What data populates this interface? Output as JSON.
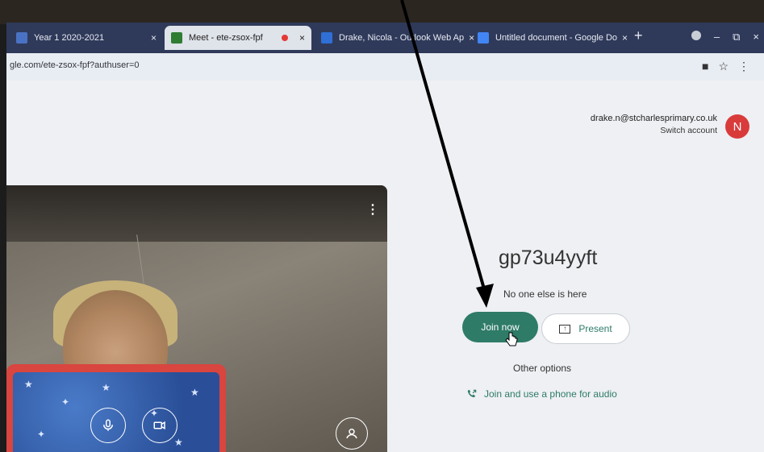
{
  "browser": {
    "tabs": [
      {
        "title": "Year 1 2020-2021",
        "close": "×",
        "favicon_color": "#4a72c4"
      },
      {
        "title": "Meet - ete-zsox-fpf",
        "close": "×",
        "favicon_color": "#2e7d32"
      },
      {
        "title": "Drake, Nicola - Outlook Web Ap",
        "close": "×",
        "favicon_color": "#2f6fd6"
      },
      {
        "title": "Untitled document - Google Do",
        "close": "×",
        "favicon_color": "#4285f4"
      }
    ],
    "new_tab_label": "+",
    "window_controls": {
      "minimize": "–",
      "restore": "⧉",
      "close": "×"
    },
    "url": "gle.com/ete-zsox-fpf?authuser=0",
    "address_icons": {
      "camera": "■",
      "bookmark": "☆",
      "menu": "⋮"
    }
  },
  "account": {
    "email": "drake.n@stcharlesprimary.co.uk",
    "switch_label": "Switch account",
    "avatar_letter": "N",
    "avatar_color": "#d93b3b"
  },
  "preview": {
    "menu_glyph": "⋮"
  },
  "meeting": {
    "code": "gp73u4yyft",
    "status": "No one else is here",
    "join_label": "Join now",
    "present_label": "Present",
    "present_icon_glyph": "↑",
    "other_options": "Other options",
    "phone_audio": "Join and use a phone for audio"
  },
  "colors": {
    "accent": "#2e7b68",
    "tabstrip": "#2f3a5a",
    "recording": "#e53935"
  }
}
